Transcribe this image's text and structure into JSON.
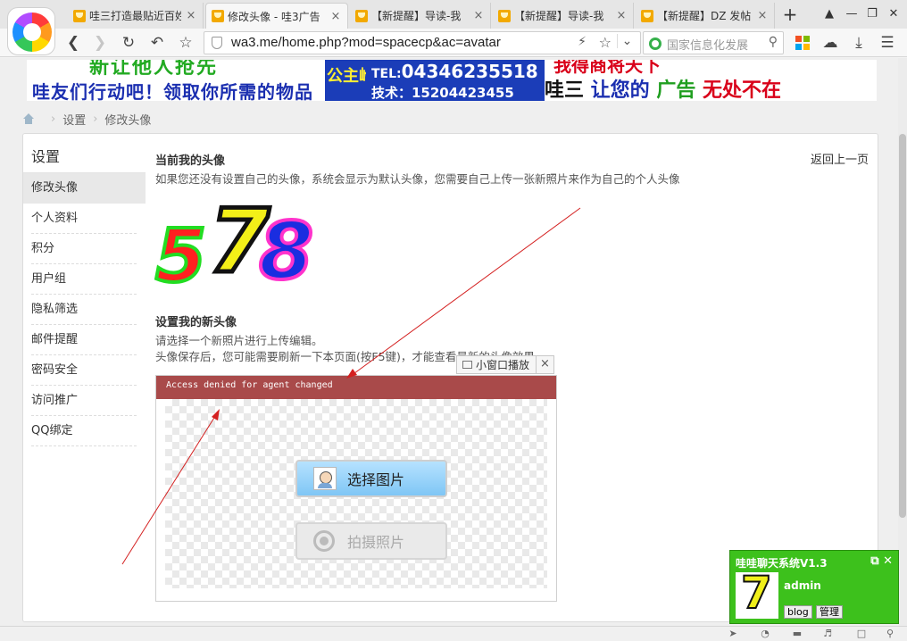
{
  "browser": {
    "tabs": [
      {
        "title": "哇三打造最贴近百姓"
      },
      {
        "title": "修改头像 - 哇3广告"
      },
      {
        "title": "【新提醒】导读-我"
      },
      {
        "title": "【新提醒】导读-我"
      },
      {
        "title": "【新提醒】DZ 发帖"
      }
    ],
    "url": "wa3.me/home.php?mod=spacecp&ac=avatar",
    "search_placeholder": "国家信息化发展",
    "tab_close": "×",
    "new_tab": "+"
  },
  "banner": {
    "slogan_top": "新让他人抢先",
    "slogan_bottom": "哇友们行动吧！领取你所需的物品",
    "brand_block": "公主岭",
    "tel_label": "TEL:",
    "tel_number": "04346235518",
    "tech_line": "技术：15204423455",
    "right_top": "我得商将天下",
    "right_bottom": [
      {
        "text": "哇三",
        "color": "#111111"
      },
      {
        "text": " 让您的 ",
        "color": "#1b2fb0"
      },
      {
        "text": "广告",
        "color": "#1f9e1f"
      },
      {
        "text": " 无处不在",
        "color": "#d9001a"
      }
    ]
  },
  "breadcrumb": {
    "items": [
      "设置",
      "修改头像"
    ]
  },
  "sidebar": {
    "title": "设置",
    "items": [
      {
        "label": "修改头像",
        "active": true
      },
      {
        "label": "个人资料"
      },
      {
        "label": "积分"
      },
      {
        "label": "用户组"
      },
      {
        "label": "隐私筛选"
      },
      {
        "label": "邮件提醒"
      },
      {
        "label": "密码安全"
      },
      {
        "label": "访问推广"
      },
      {
        "label": "QQ绑定"
      }
    ]
  },
  "main": {
    "back_link": "返回上一页",
    "current_title": "当前我的头像",
    "current_desc": "如果您还没有设置自己的头像，系统会显示为默认头像，您需要自己上传一张新照片来作为自己的个人头像",
    "avatar_digits": [
      "5",
      "7",
      "8"
    ],
    "new_title": "设置我的新头像",
    "new_desc1": "请选择一个新照片进行上传编辑。",
    "new_desc2": "头像保存后，您可能需要刷新一下本页面(按F5键)，才能查看最新的头像效果",
    "uploader": {
      "error": "Access denied for agent changed",
      "select_label": "选择图片",
      "camera_label": "拍摄照片"
    }
  },
  "mini_player": {
    "label": "小窗口播放",
    "close": "×"
  },
  "chat": {
    "title": "哇哇聊天系统V1.3",
    "controls": "⧉ ✕",
    "avatar_digit": "7",
    "username": "admin",
    "blog_label": "blog",
    "manage_label": "管理"
  },
  "colors": {
    "accent_green": "#3dc11c",
    "error_red": "#a94a4a",
    "select_blue": "#7fc6f5"
  }
}
